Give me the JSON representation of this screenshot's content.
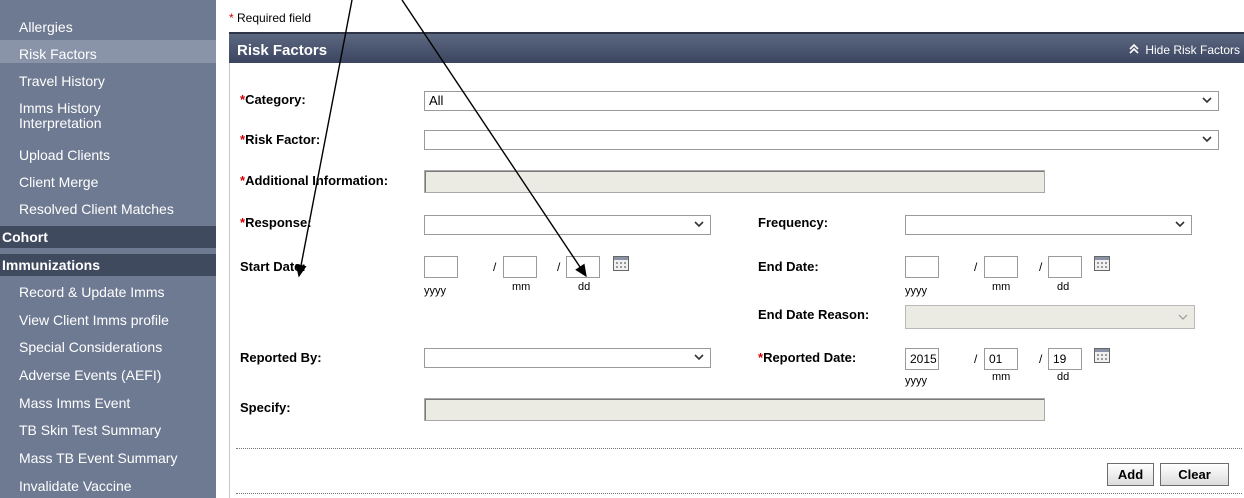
{
  "sidebar": {
    "items": [
      {
        "label": "Allergies"
      },
      {
        "label": "Risk Factors"
      },
      {
        "label": "Travel History"
      },
      {
        "label": "Imms History\nInterpretation"
      },
      {
        "label": "Upload Clients"
      },
      {
        "label": "Client Merge"
      },
      {
        "label": "Resolved Client Matches"
      }
    ],
    "cohort_label": "Cohort",
    "immunizations_label": "Immunizations",
    "imm_items": [
      {
        "label": "Record & Update Imms"
      },
      {
        "label": "View Client Imms profile"
      },
      {
        "label": "Special Considerations"
      },
      {
        "label": "Adverse Events (AEFI)"
      },
      {
        "label": "Mass Imms Event"
      },
      {
        "label": "TB Skin Test Summary"
      },
      {
        "label": "Mass TB Event Summary"
      },
      {
        "label": "Invalidate Vaccine"
      }
    ]
  },
  "required_note": "Required field",
  "required_star": "*",
  "panel": {
    "title": "Risk Factors",
    "hide_link": "Hide Risk Factors"
  },
  "form": {
    "category_label": "Category:",
    "category_value": "All",
    "risk_factor_label": "Risk Factor:",
    "risk_factor_value": "",
    "additional_info_label": "Additional Information:",
    "response_label": "Response:",
    "frequency_label": "Frequency:",
    "start_date_label": "Start Date:",
    "end_date_label": "End Date:",
    "end_date_reason_label": "End Date Reason:",
    "reported_by_label": "Reported By:",
    "reported_date_label": "Reported Date:",
    "specify_label": "Specify:",
    "date_slash": "/",
    "unit_yyyy": "yyyy",
    "unit_mm": "mm",
    "unit_dd": "dd",
    "reported_date": {
      "yyyy": "2015",
      "mm": "01",
      "dd": "19"
    }
  },
  "buttons": {
    "add": "Add",
    "clear": "Clear"
  },
  "icons": {
    "dropdown": "chevron-down-icon",
    "calendar": "calendar-icon",
    "collapse": "double-chevron-up-icon"
  }
}
